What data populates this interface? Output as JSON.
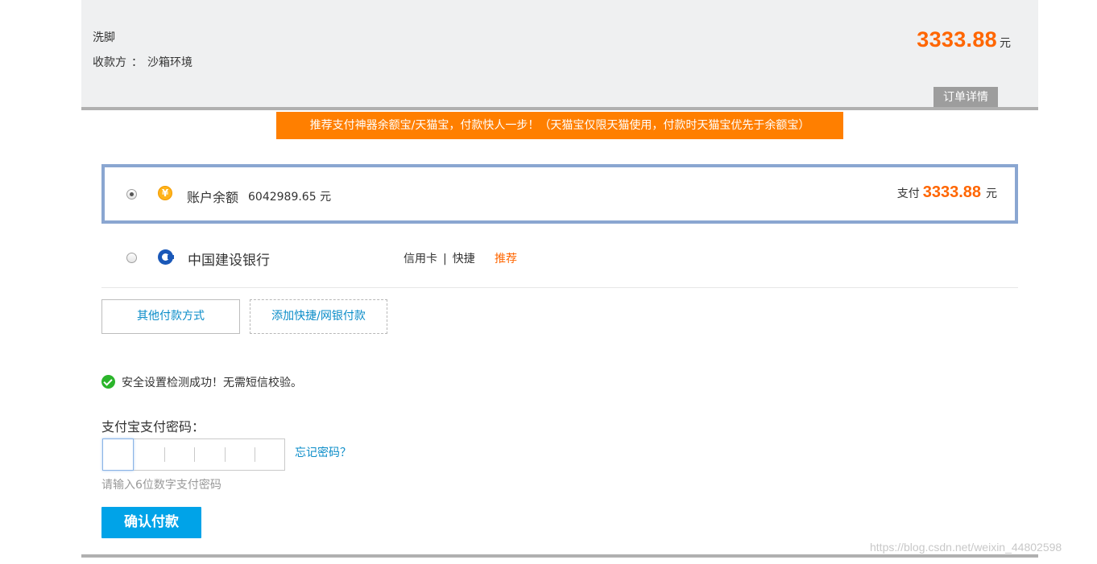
{
  "header": {
    "order_name": "洗脚",
    "payee_label": "收款方",
    "payee_sep": "：",
    "payee_name": "沙箱环境",
    "amount": "3333.88",
    "amount_unit": "元",
    "order_detail_tab": "订单详情"
  },
  "promo_banner": "推荐支付神器余额宝/天猫宝，付款快人一步！（天猫宝仅限天猫使用，付款时天猫宝优先于余额宝）",
  "payment_methods": {
    "balance": {
      "icon": "yen-icon",
      "icon_glyph": "¥",
      "label": "账户余额",
      "amount": "6042989.65 元",
      "pay_label": "支付",
      "pay_amount": "3333.88",
      "pay_unit": "元",
      "selected": true
    },
    "bank": {
      "icon": "ccb-bank-icon",
      "name": "中国建设银行",
      "type_credit": "信用卡",
      "type_sep": "|",
      "type_quick": "快捷",
      "recommend": "推荐",
      "selected": false
    }
  },
  "buttons": {
    "other_methods": "其他付款方式",
    "add_quick": "添加快捷/网银付款",
    "confirm": "确认付款"
  },
  "security": {
    "icon": "check-circle-icon",
    "message": "安全设置检测成功！无需短信校验。"
  },
  "password": {
    "label": "支付宝支付密码：",
    "forgot": "忘记密码？",
    "hint": "请输入6位数字支付密码",
    "length": 6
  },
  "watermark": "https://blog.csdn.net/weixin_44802598",
  "colors": {
    "accent_orange": "#ff6600",
    "banner_orange": "#ff7f00",
    "link_blue": "#0a8cc8",
    "confirm_blue": "#00a3e8",
    "selected_border": "#8aa6d1",
    "success_green": "#2bb52b"
  }
}
